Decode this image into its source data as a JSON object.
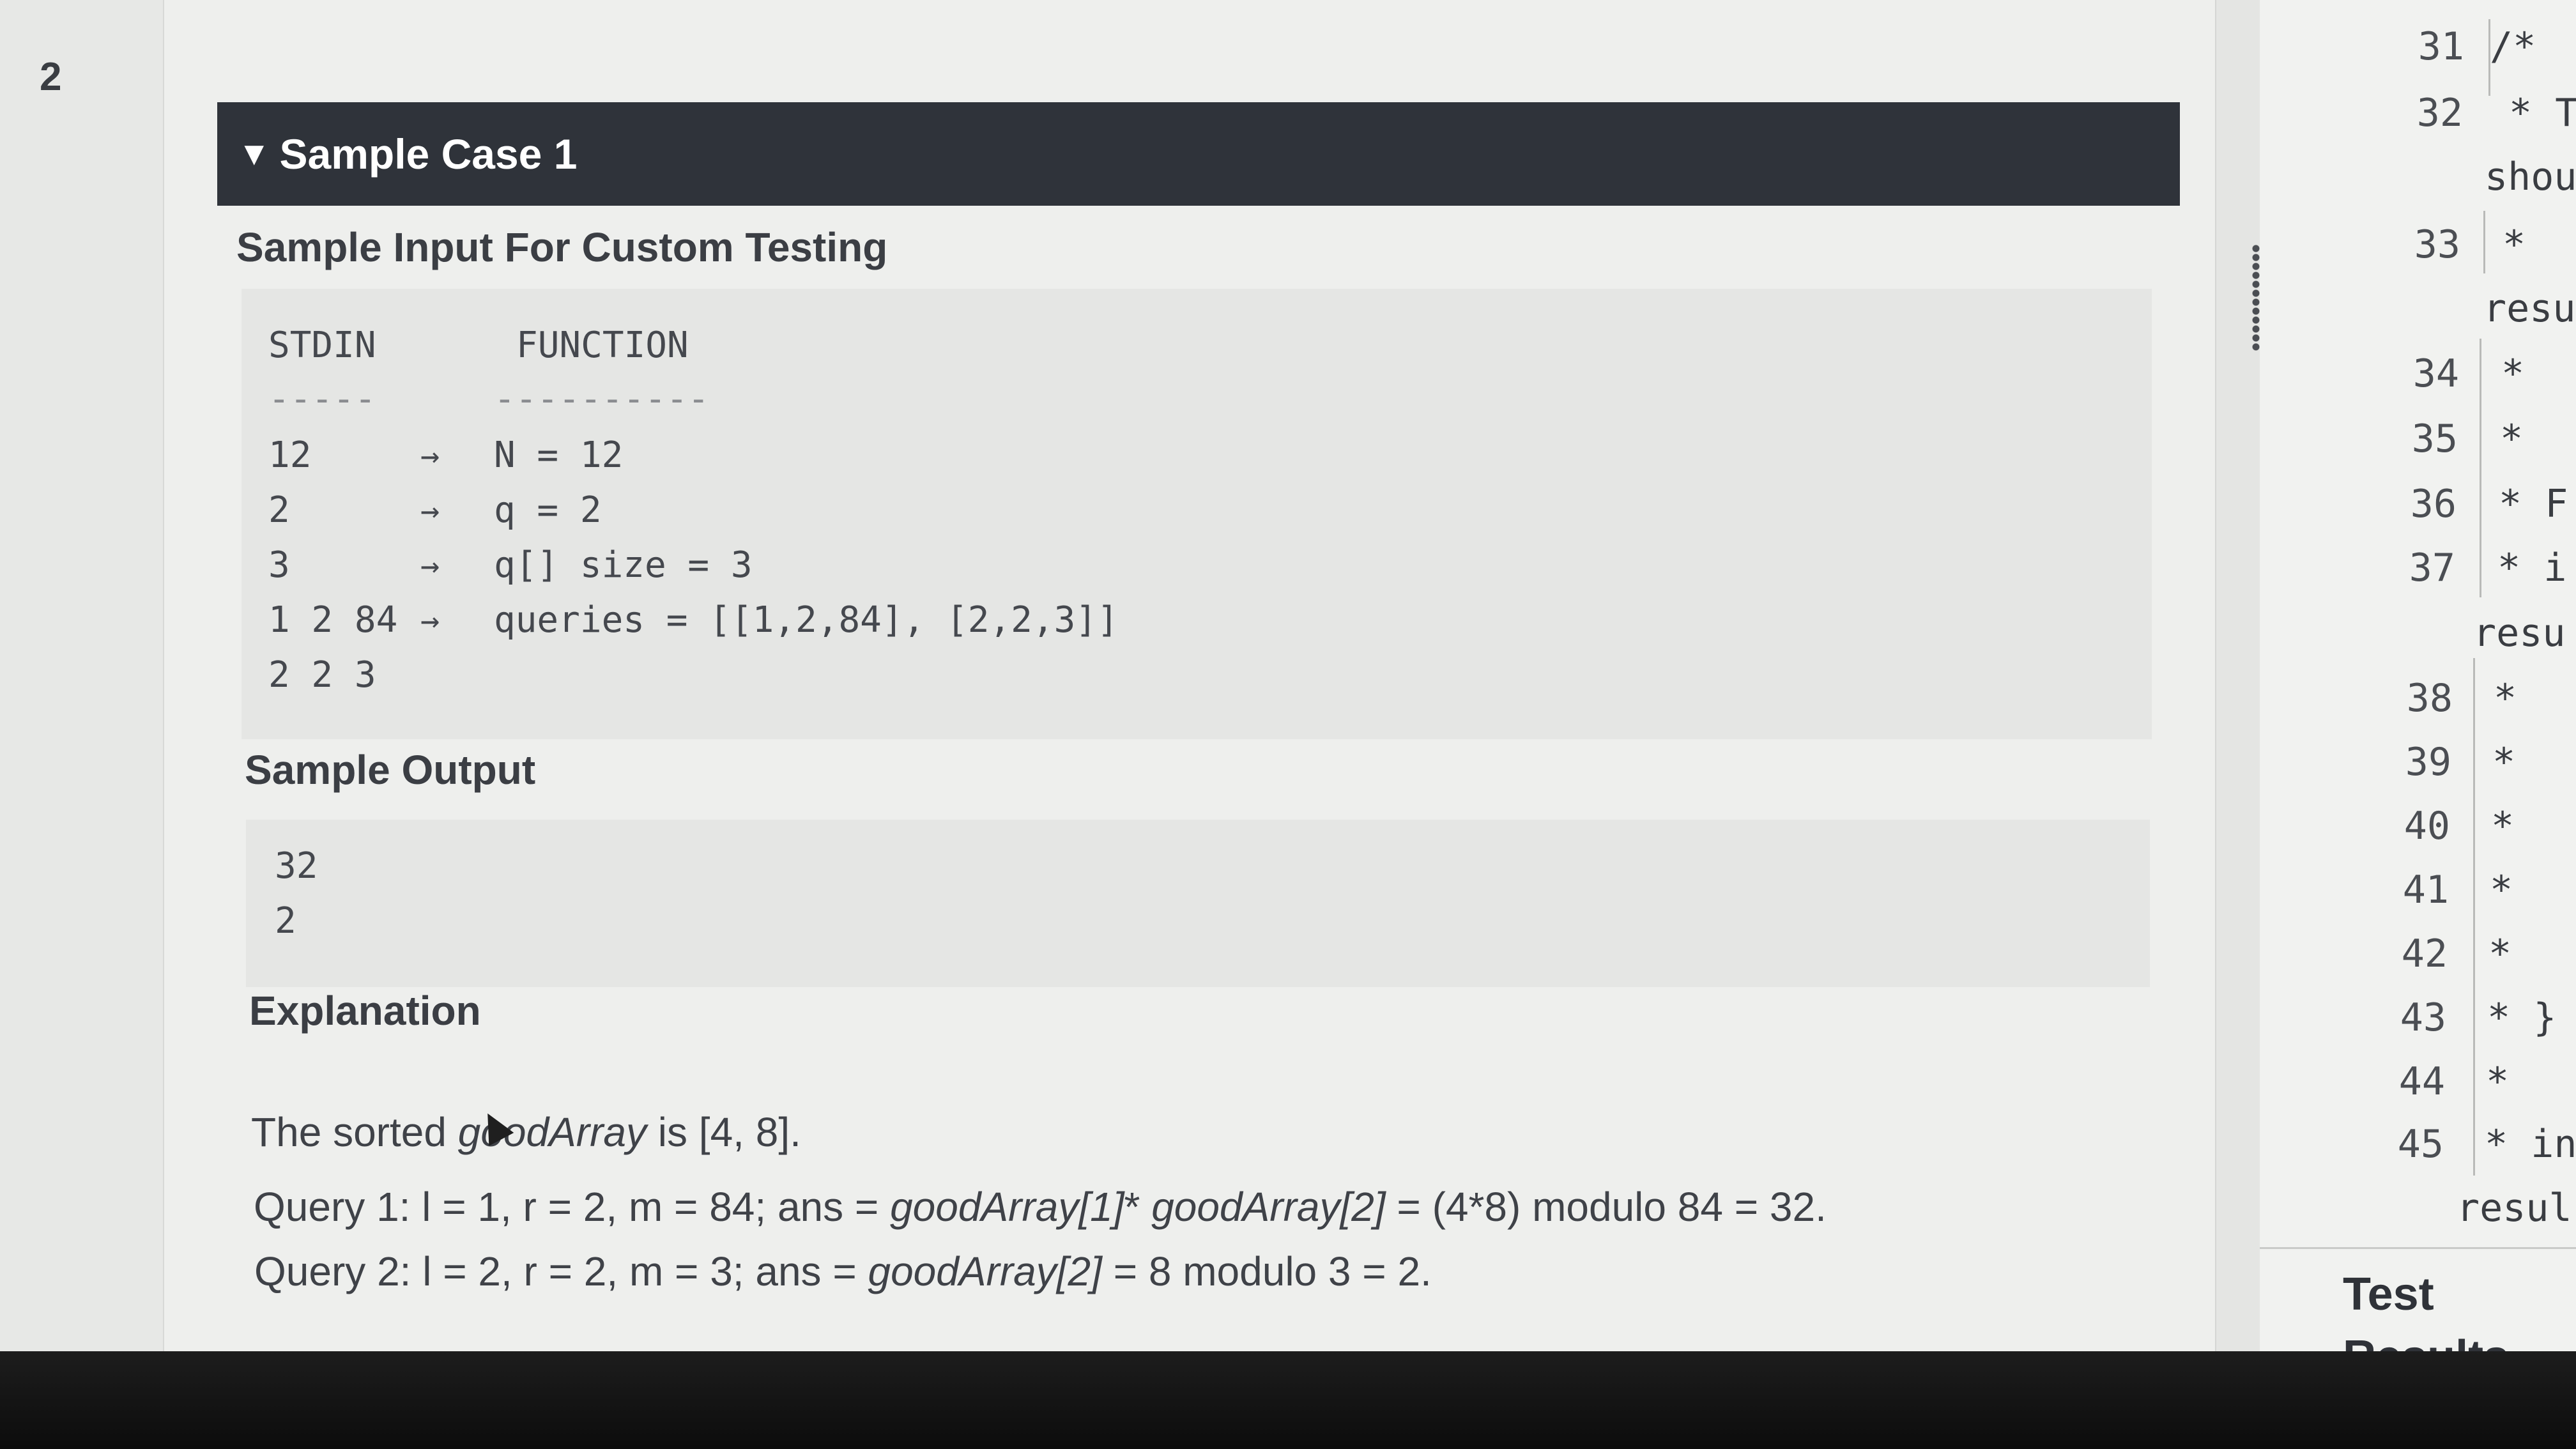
{
  "page_number": "2",
  "sample_case": {
    "toggle_icon": "triangle-down-icon",
    "title": "Sample Case 1"
  },
  "sample_input": {
    "heading": "Sample Input For Custom Testing",
    "col_stdin": "STDIN",
    "col_function": "FUNCTION",
    "rule_stdin": "-----",
    "rule_function": "----------",
    "rows": [
      {
        "stdin": "12",
        "arrow": "→",
        "function": "N = 12"
      },
      {
        "stdin": "2",
        "arrow": "→",
        "function": "q = 2"
      },
      {
        "stdin": "3",
        "arrow": "→",
        "function": "q[] size = 3"
      },
      {
        "stdin": "1 2 84",
        "arrow": "→",
        "function": "queries = [[1,2,84], [2,2,3]]"
      },
      {
        "stdin": "2 2 3",
        "arrow": "",
        "function": ""
      }
    ]
  },
  "sample_output": {
    "heading": "Sample Output",
    "lines": [
      "32",
      "2"
    ]
  },
  "explanation": {
    "heading": "Explanation",
    "line1_pre": "The sorted ",
    "line1_italic": "goodArray",
    "line1_post": " is [4, 8].",
    "line2_pre": "Query 1: l = 1, r = 2, m = 84; ans = ",
    "line2_italic1": "goodArray[1]",
    "line2_mid": "* ",
    "line2_italic2": "goodArray[2]",
    "line2_post": " = (4*8) modulo 84 = 32.",
    "line3_pre": "Query 2: l = 2, r = 2, m = 3; ans = ",
    "line3_italic": "goodArray[2]",
    "line3_post": " = 8 modulo 3 = 2."
  },
  "editor": {
    "lines": [
      {
        "num": "31",
        "text": "/*"
      },
      {
        "num": "32",
        "text": "* T"
      },
      {
        "num": "",
        "text": "shou"
      },
      {
        "num": "33",
        "text": "*"
      },
      {
        "num": "",
        "text": "resu"
      },
      {
        "num": "34",
        "text": "*"
      },
      {
        "num": "35",
        "text": "*"
      },
      {
        "num": "36",
        "text": "* F"
      },
      {
        "num": "37",
        "text": "* i"
      },
      {
        "num": "",
        "text": "resu"
      },
      {
        "num": "38",
        "text": "*"
      },
      {
        "num": "39",
        "text": "*"
      },
      {
        "num": "40",
        "text": "*"
      },
      {
        "num": "41",
        "text": "*"
      },
      {
        "num": "42",
        "text": "*"
      },
      {
        "num": "43",
        "text": "* }"
      },
      {
        "num": "44",
        "text": "*"
      },
      {
        "num": "45",
        "text": "* in"
      },
      {
        "num": "",
        "text": "resul"
      }
    ]
  },
  "test_results": {
    "line1": "Test",
    "line2": "Results"
  }
}
